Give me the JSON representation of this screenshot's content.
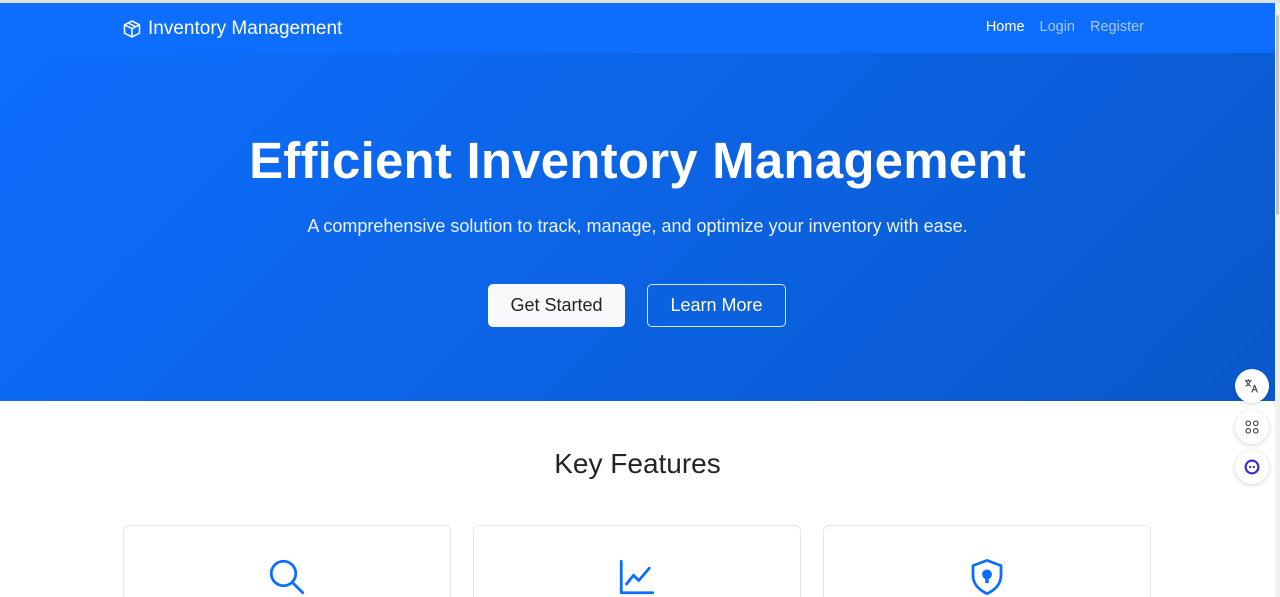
{
  "navbar": {
    "brand_icon": "box-icon",
    "brand": "Inventory Management",
    "links": [
      {
        "label": "Home",
        "active": true
      },
      {
        "label": "Login",
        "active": false
      },
      {
        "label": "Register",
        "active": false
      }
    ]
  },
  "hero": {
    "title": "Efficient Inventory Management",
    "subtitle": "A comprehensive solution to track, manage, and optimize your inventory with ease.",
    "primary_button": "Get Started",
    "secondary_button": "Learn More"
  },
  "features": {
    "title": "Key Features",
    "cards": [
      {
        "icon": "search-icon"
      },
      {
        "icon": "line-chart-icon"
      },
      {
        "icon": "shield-lock-icon"
      }
    ]
  },
  "side_tools": [
    {
      "icon": "translate-icon"
    },
    {
      "icon": "apps-icon"
    },
    {
      "icon": "assistant-icon"
    }
  ],
  "colors": {
    "primary": "#0d6efd",
    "hero_gradient_end": "#0a58ca",
    "text_dark": "#212529"
  }
}
